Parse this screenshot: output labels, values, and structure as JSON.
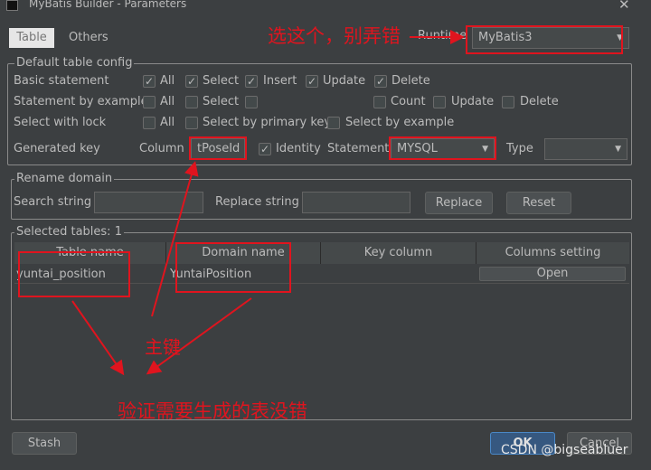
{
  "window": {
    "title": "MyBatis Builder - Parameters",
    "close": "✕"
  },
  "tabs": [
    {
      "label": "Table"
    },
    {
      "label": "Others"
    }
  ],
  "runtime": {
    "label": "Runtime",
    "value": "MyBatis3"
  },
  "default_config": {
    "legend": "Default table config",
    "rows": [
      {
        "label": "Basic statement",
        "items": [
          {
            "label": "All",
            "checked": true
          },
          {
            "label": "Select",
            "checked": true
          },
          {
            "label": "Insert",
            "checked": true
          },
          {
            "label": "Update",
            "checked": true
          },
          {
            "label": "Delete",
            "checked": true
          }
        ]
      },
      {
        "label": "Statement by example",
        "items": [
          {
            "label": "All",
            "checked": false
          },
          {
            "label": "Select",
            "checked": false
          },
          {
            "label": "",
            "checked": false
          },
          {
            "label": "Count",
            "checked": false
          },
          {
            "label": "Update",
            "checked": false
          },
          {
            "label": "Delete",
            "checked": false
          }
        ]
      },
      {
        "label": "Select with lock",
        "items": [
          {
            "label": "All",
            "checked": false
          },
          {
            "label": "Select by primary key",
            "checked": false
          },
          {
            "label": "Select by example",
            "checked": false
          }
        ]
      }
    ],
    "generated_key": {
      "label": "Generated key",
      "column_label": "Column",
      "column_value": "tPoseId",
      "identity_label": "Identity",
      "identity_checked": true,
      "statement_label": "Statement",
      "statement_value": "MYSQL",
      "type_label": "Type",
      "type_value": ""
    }
  },
  "rename_domain": {
    "legend": "Rename domain",
    "search_label": "Search string",
    "search_value": "",
    "replace_label": "Replace string",
    "replace_value": "",
    "replace_button": "Replace",
    "reset_button": "Reset"
  },
  "selected_tables": {
    "legend": "Selected tables: 1",
    "columns": [
      "Table name",
      "Domain name",
      "Key column",
      "Columns setting"
    ],
    "rows": [
      {
        "table_name": "yuntai_position",
        "domain_name": "YuntaiPosition",
        "key_column": "",
        "button": "Open"
      }
    ]
  },
  "footer": {
    "stash": "Stash",
    "ok": "OK",
    "cancel": "Cancel"
  },
  "annotations": {
    "runtime_note": "选这个，别弄错",
    "pk_note": "主键",
    "table_note": "验证需要生成的表没错",
    "watermark": "CSDN @bigseabluer"
  }
}
